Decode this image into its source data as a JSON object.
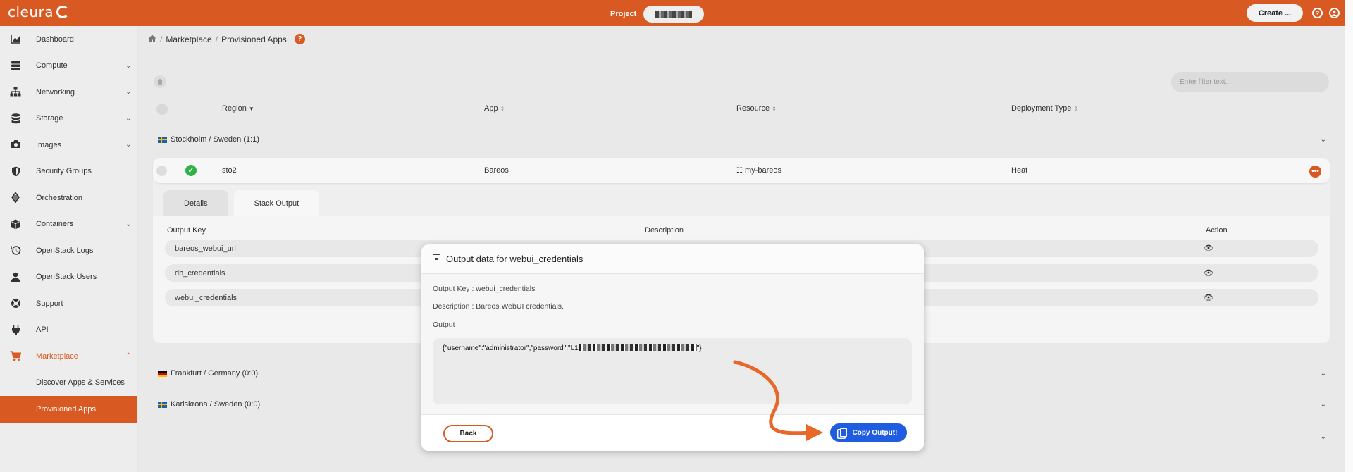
{
  "header": {
    "logo_text": "cleura",
    "project_label": "Project",
    "create_label": "Create ...",
    "help_icon": "?",
    "user_icon": "user-icon"
  },
  "sidebar": {
    "items": [
      {
        "label": "Dashboard",
        "icon": "chart-icon"
      },
      {
        "label": "Compute",
        "icon": "server-icon",
        "expandable": true
      },
      {
        "label": "Networking",
        "icon": "network-icon",
        "expandable": true
      },
      {
        "label": "Storage",
        "icon": "database-icon",
        "expandable": true
      },
      {
        "label": "Images",
        "icon": "camera-icon",
        "expandable": true
      },
      {
        "label": "Security Groups",
        "icon": "shield-icon"
      },
      {
        "label": "Orchestration",
        "icon": "orchestration-icon"
      },
      {
        "label": "Containers",
        "icon": "cube-icon",
        "expandable": true
      },
      {
        "label": "OpenStack Logs",
        "icon": "history-icon"
      },
      {
        "label": "OpenStack Users",
        "icon": "user-icon"
      },
      {
        "label": "Support",
        "icon": "lifebuoy-icon"
      },
      {
        "label": "API",
        "icon": "plug-icon"
      },
      {
        "label": "Marketplace",
        "icon": "cart-icon",
        "expandable": true,
        "active": true
      }
    ],
    "sub_items": [
      {
        "label": "Discover Apps & Services"
      },
      {
        "label": "Provisioned Apps",
        "selected": true
      }
    ]
  },
  "breadcrumb": {
    "section": "Marketplace",
    "current": "Provisioned Apps"
  },
  "filter": {
    "placeholder": "Enter filter text..."
  },
  "table": {
    "columns": [
      "Region",
      "App",
      "Resource",
      "Deployment Type"
    ],
    "groups": [
      {
        "label": "Stockholm / Sweden",
        "count": "(1:1)"
      },
      {
        "label": "Frankfurt / Germany",
        "count": "(0:0)"
      },
      {
        "label": "Karlskrona / Sweden",
        "count": "(0:0)"
      }
    ],
    "row": {
      "region": "sto2",
      "app": "Bareos",
      "resource": "my-bareos",
      "deployment_type": "Heat"
    }
  },
  "detail_tabs": [
    "Details",
    "Stack Output"
  ],
  "outputs": {
    "headers": {
      "key": "Output Key",
      "description": "Description",
      "action": "Action"
    },
    "rows": [
      "bareos_webui_url",
      "db_credentials",
      "webui_credentials"
    ]
  },
  "modal": {
    "title": "Output data for webui_credentials",
    "output_key_line": "Output Key : webui_credentials",
    "description_line": "Description : Bareos WebUI credentials.",
    "output_label": "Output",
    "output_prefix": "{\"username\":\"administrator\",\"password\":\"L1",
    "output_suffix": "\"}",
    "back_label": "Back",
    "copy_label": "Copy Output!"
  },
  "colors": {
    "brand": "#d85a22",
    "primary_button": "#1f5ce0",
    "success": "#2fb24a"
  }
}
